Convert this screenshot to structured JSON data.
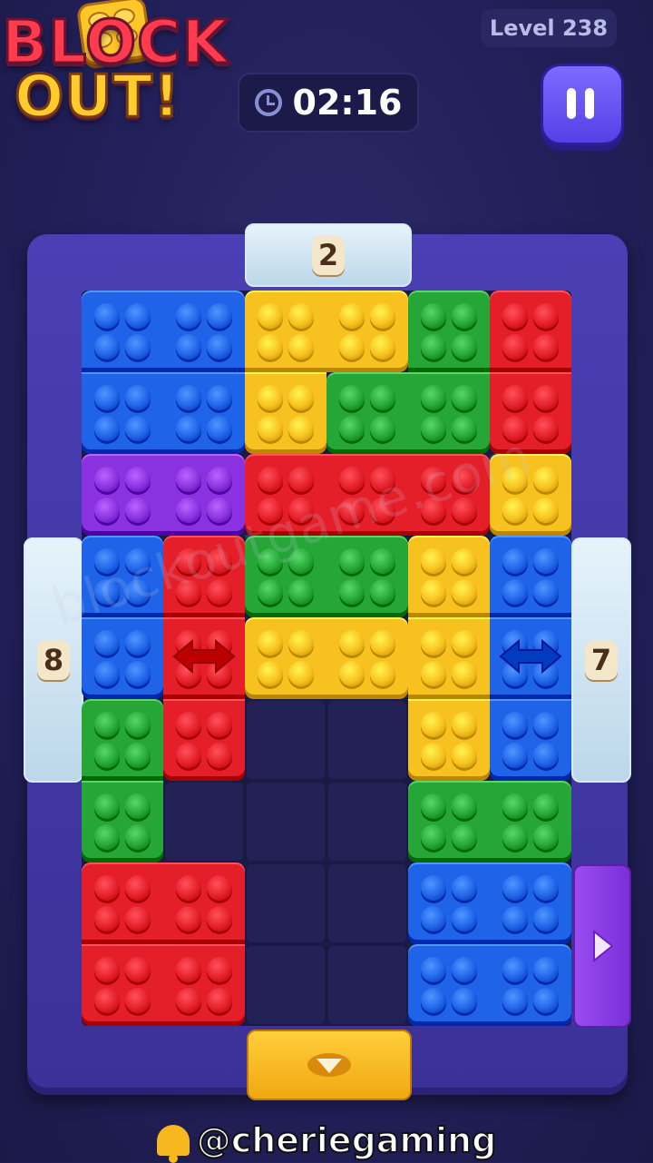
{
  "header": {
    "logo_line1": "BLOCK",
    "logo_line2": "OUT!",
    "level_label": "Level 238",
    "timer": "02:16"
  },
  "gates": {
    "top": {
      "count": "2",
      "color": "ice"
    },
    "left": {
      "count": "8",
      "color": "ice"
    },
    "right": {
      "count": "7",
      "color": "ice"
    },
    "bottom": {
      "color": "#f5b81e",
      "icon": "down-arrow-icon"
    },
    "right_lower": {
      "color": "#8a3be6",
      "icon": "right-arrow-icon"
    }
  },
  "colors": {
    "blue": "#1f64e8",
    "yellow": "#f7c21f",
    "green": "#25a637",
    "red": "#e41f2a",
    "purple": "#8a32e0"
  },
  "board": {
    "columns": 6,
    "rows": 9
  },
  "blocks": [
    {
      "color": "blue",
      "cells": [
        [
          0,
          0
        ],
        [
          1,
          0
        ],
        [
          0,
          1
        ],
        [
          1,
          1
        ]
      ]
    },
    {
      "color": "yellow",
      "cells": [
        [
          2,
          0
        ],
        [
          3,
          0
        ],
        [
          2,
          1
        ]
      ]
    },
    {
      "color": "green",
      "cells": [
        [
          4,
          0
        ],
        [
          3,
          1
        ],
        [
          4,
          1
        ]
      ]
    },
    {
      "color": "red",
      "cells": [
        [
          5,
          0
        ],
        [
          5,
          1
        ]
      ]
    },
    {
      "color": "purple",
      "cells": [
        [
          0,
          2
        ],
        [
          1,
          2
        ]
      ]
    },
    {
      "color": "red",
      "cells": [
        [
          2,
          2
        ],
        [
          3,
          2
        ],
        [
          4,
          2
        ]
      ]
    },
    {
      "color": "yellow",
      "cells": [
        [
          5,
          2
        ]
      ]
    },
    {
      "color": "blue",
      "cells": [
        [
          0,
          3
        ],
        [
          0,
          4
        ]
      ]
    },
    {
      "color": "red",
      "cells": [
        [
          1,
          3
        ],
        [
          1,
          4
        ],
        [
          1,
          5
        ]
      ],
      "arrow": "horizontal"
    },
    {
      "color": "green",
      "cells": [
        [
          2,
          3
        ],
        [
          3,
          3
        ]
      ]
    },
    {
      "color": "yellow",
      "cells": [
        [
          2,
          4
        ],
        [
          3,
          4
        ]
      ]
    },
    {
      "color": "yellow",
      "cells": [
        [
          4,
          3
        ],
        [
          4,
          4
        ],
        [
          4,
          5
        ]
      ]
    },
    {
      "color": "blue",
      "cells": [
        [
          5,
          3
        ],
        [
          5,
          4
        ],
        [
          5,
          5
        ]
      ],
      "arrow": "horizontal"
    },
    {
      "color": "green",
      "cells": [
        [
          0,
          5
        ],
        [
          0,
          6
        ]
      ]
    },
    {
      "color": "green",
      "cells": [
        [
          4,
          6
        ],
        [
          5,
          6
        ]
      ]
    },
    {
      "color": "red",
      "cells": [
        [
          0,
          7
        ],
        [
          1,
          7
        ],
        [
          0,
          8
        ],
        [
          1,
          8
        ]
      ]
    },
    {
      "color": "blue",
      "cells": [
        [
          4,
          7
        ],
        [
          5,
          7
        ]
      ]
    },
    {
      "color": "blue",
      "cells": [
        [
          4,
          8
        ],
        [
          5,
          8
        ]
      ]
    }
  ],
  "watermark": "blockoutgame.com",
  "footer": {
    "handle": "@cheriegaming"
  }
}
